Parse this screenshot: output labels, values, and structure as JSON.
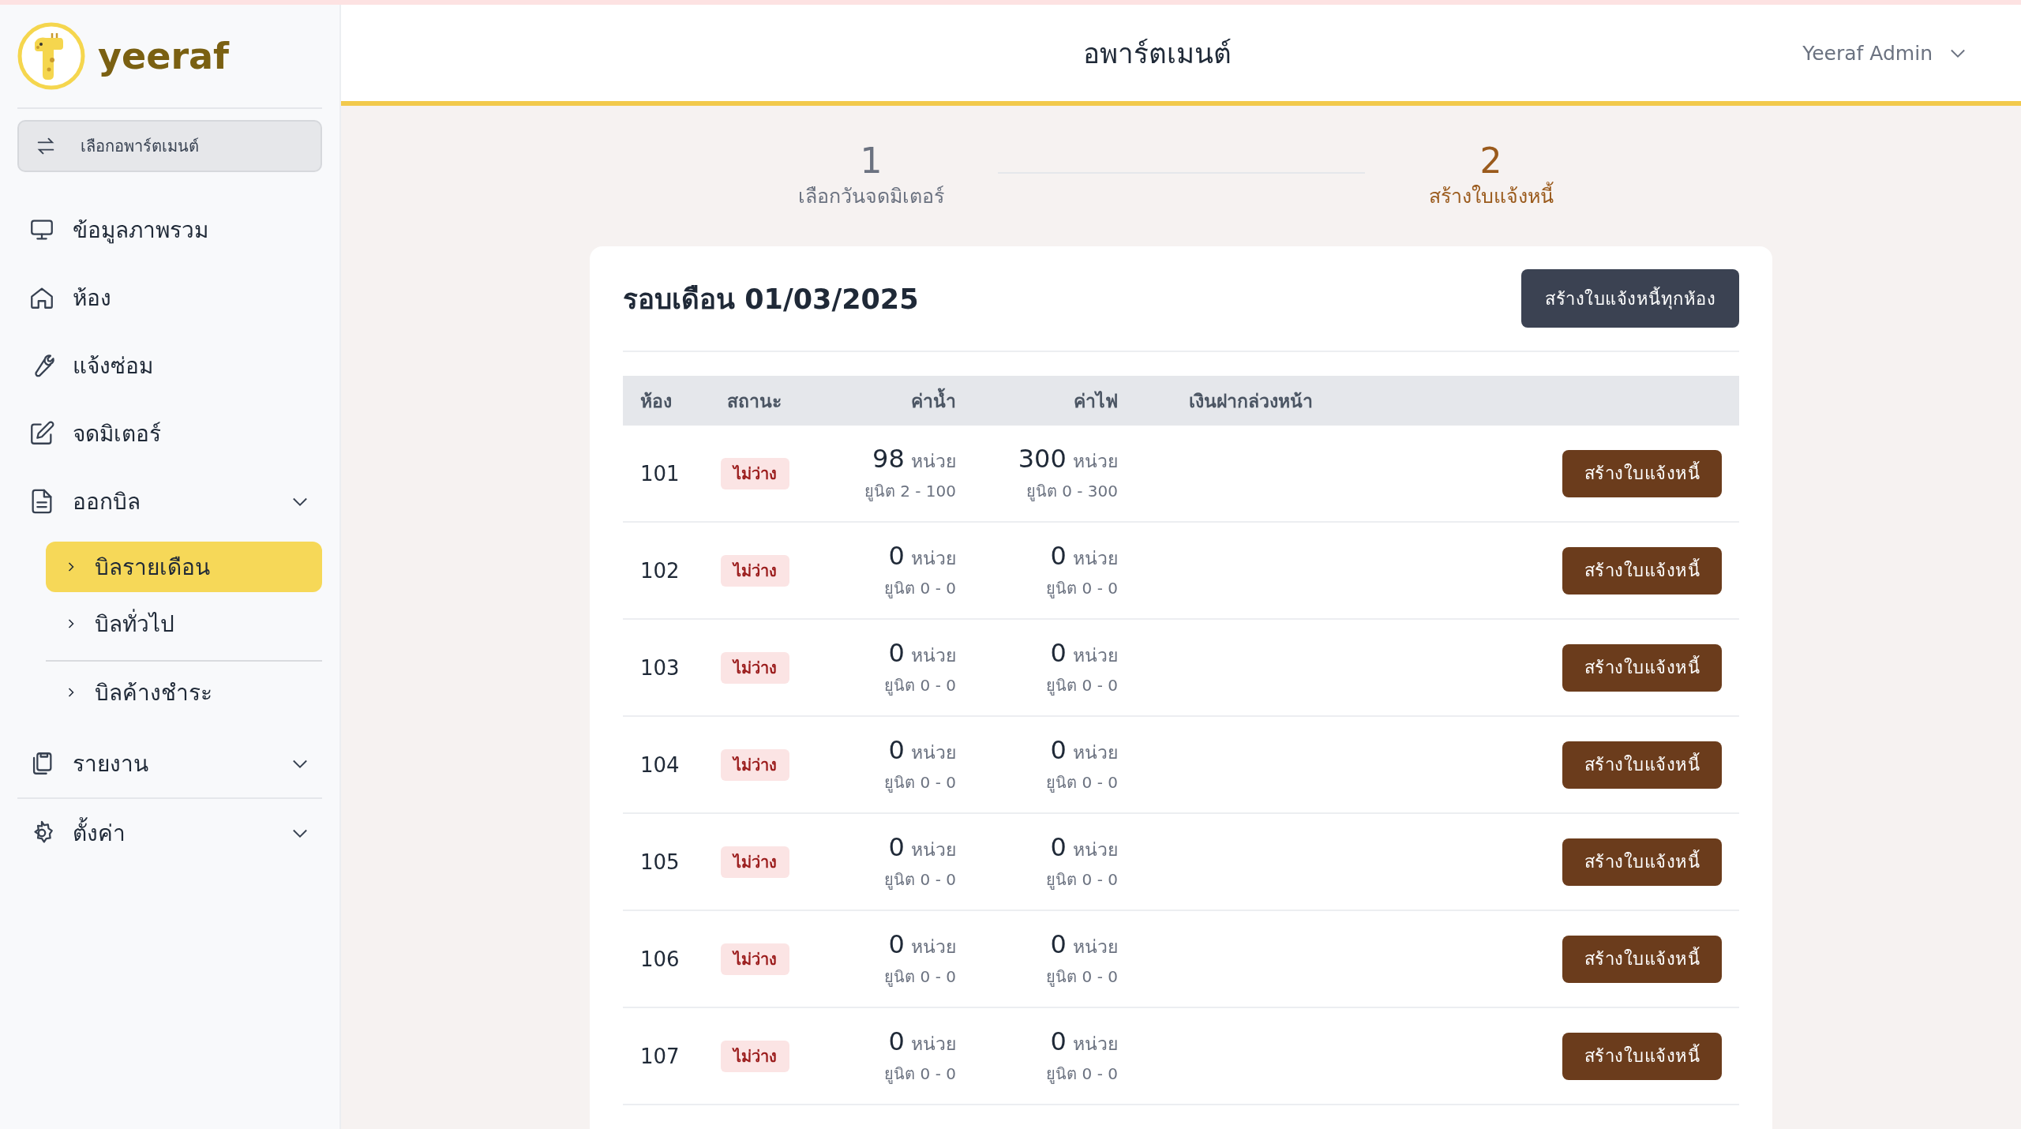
{
  "sidebar": {
    "logo": "yeeraf",
    "apartment_selector": "เลือกอพาร์ตเมนต์",
    "items": [
      {
        "kind": "link",
        "label": "ข้อมูลภาพรวม"
      },
      {
        "kind": "link",
        "label": "ห้อง"
      },
      {
        "kind": "link",
        "label": "แจ้งซ่อม"
      },
      {
        "kind": "link",
        "label": "จดมิเตอร์"
      },
      {
        "kind": "group",
        "label": "ออกบิล",
        "children": [
          {
            "label": "บิลรายเดือน",
            "selected": true
          },
          {
            "label": "บิลทั่วไป",
            "selected": false
          },
          {
            "label": "บิลค้างชำระ",
            "selected": false
          }
        ]
      },
      {
        "kind": "group",
        "label": "รายงาน"
      },
      {
        "kind": "group",
        "label": "ตั้งค่า"
      }
    ]
  },
  "header": {
    "title": "อพาร์ตเมนต์",
    "user": "Yeeraf Admin"
  },
  "steps": [
    {
      "number": "1",
      "label": "เลือกวันจดมิเตอร์",
      "selected": false
    },
    {
      "number": "2",
      "label": "สร้างใบแจ้งหนี้",
      "selected": true
    }
  ],
  "card": {
    "title": "รอบเดือน 01/03/2025",
    "action": "สร้างใบแจ้งหนี้ทุกห้อง",
    "columns": [
      "ห้อง",
      "สถานะ",
      "ค่าน้ำ",
      "ค่าไฟ",
      "เงินฝากล่วงหน้า"
    ],
    "rows": [
      {
        "room": "101",
        "status": "ไม่ว่าง",
        "water": "98",
        "water_unit": "หน่วย",
        "water_range": "ยูนิต 2 - 100",
        "electric": "300",
        "electric_unit": "หน่วย",
        "electric_range": "ยูนิต 0 - 300",
        "button": "สร้างใบแจ้งหนี้"
      },
      {
        "room": "102",
        "status": "ไม่ว่าง",
        "water": "0",
        "water_unit": "หน่วย",
        "water_range": "ยูนิต 0 - 0",
        "electric": "0",
        "electric_unit": "หน่วย",
        "electric_range": "ยูนิต 0 - 0",
        "button": "สร้างใบแจ้งหนี้"
      },
      {
        "room": "103",
        "status": "ไม่ว่าง",
        "water": "0",
        "water_unit": "หน่วย",
        "water_range": "ยูนิต 0 - 0",
        "electric": "0",
        "electric_unit": "หน่วย",
        "electric_range": "ยูนิต 0 - 0",
        "button": "สร้างใบแจ้งหนี้"
      },
      {
        "room": "104",
        "status": "ไม่ว่าง",
        "water": "0",
        "water_unit": "หน่วย",
        "water_range": "ยูนิต 0 - 0",
        "electric": "0",
        "electric_unit": "หน่วย",
        "electric_range": "ยูนิต 0 - 0",
        "button": "สร้างใบแจ้งหนี้"
      },
      {
        "room": "105",
        "status": "ไม่ว่าง",
        "water": "0",
        "water_unit": "หน่วย",
        "water_range": "ยูนิต 0 - 0",
        "electric": "0",
        "electric_unit": "หน่วย",
        "electric_range": "ยูนิต 0 - 0",
        "button": "สร้างใบแจ้งหนี้"
      },
      {
        "room": "106",
        "status": "ไม่ว่าง",
        "water": "0",
        "water_unit": "หน่วย",
        "water_range": "ยูนิต 0 - 0",
        "electric": "0",
        "electric_unit": "หน่วย",
        "electric_range": "ยูนิต 0 - 0",
        "button": "สร้างใบแจ้งหนี้"
      },
      {
        "room": "107",
        "status": "ไม่ว่าง",
        "water": "0",
        "water_unit": "หน่วย",
        "water_range": "ยูนิต 0 - 0",
        "electric": "0",
        "electric_unit": "หน่วย",
        "electric_range": "ยูนิต 0 - 0",
        "button": "สร้างใบแจ้งหนี้"
      }
    ]
  }
}
